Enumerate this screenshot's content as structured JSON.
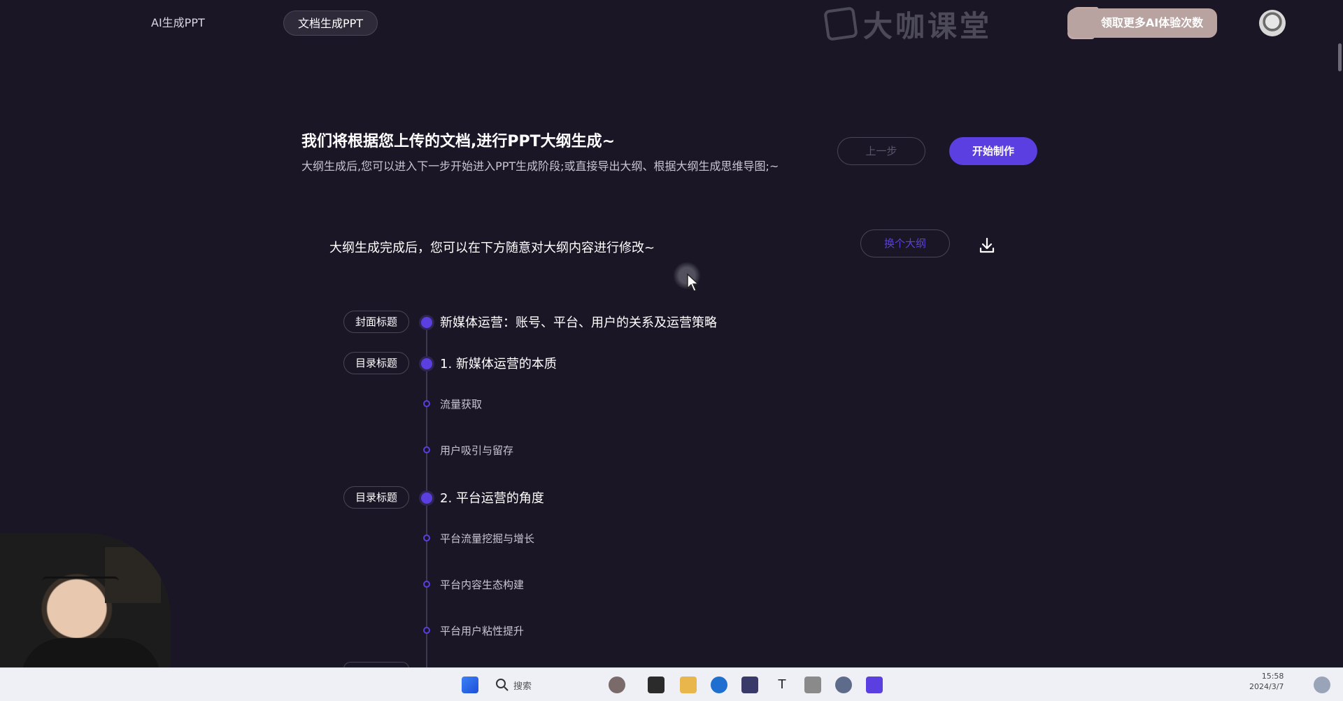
{
  "nav": {
    "tabs": [
      {
        "label": "AI生成PPT"
      },
      {
        "label": "文档生成PPT"
      }
    ],
    "brand": "大咖课堂",
    "promo_button": "领取更多AI体验次数"
  },
  "header": {
    "title": "我们将根据您上传的文档,进行PPT大纲生成~",
    "subtitle": "大纲生成后,您可以进入下一步开始进入PPT生成阶段;或直接导出大纲、根据大纲生成思维导图;~",
    "prev_button": "上一步",
    "start_button": "开始制作"
  },
  "outline": {
    "hint": "大纲生成完成后，您可以在下方随意对大纲内容进行修改~",
    "swap_button": "换个大纲",
    "items": [
      {
        "tag": "封面标题",
        "text": "新媒体运营：账号、平台、用户的关系及运营策略"
      },
      {
        "tag": "目录标题",
        "text": "1. 新媒体运营的本质"
      },
      {
        "tag": "",
        "text": "流量获取"
      },
      {
        "tag": "",
        "text": "用户吸引与留存"
      },
      {
        "tag": "目录标题",
        "text": "2. 平台运营的角度"
      },
      {
        "tag": "",
        "text": "平台流量挖掘与增长"
      },
      {
        "tag": "",
        "text": "平台内容生态构建"
      },
      {
        "tag": "",
        "text": "平台用户粘性提升"
      }
    ]
  },
  "taskbar": {
    "search_label": "搜索",
    "time": "15:58",
    "date": "2024/3/7"
  },
  "colors": {
    "background": "#1a1626",
    "accent": "#5b3fe0",
    "promo": "#b9a3a1"
  }
}
